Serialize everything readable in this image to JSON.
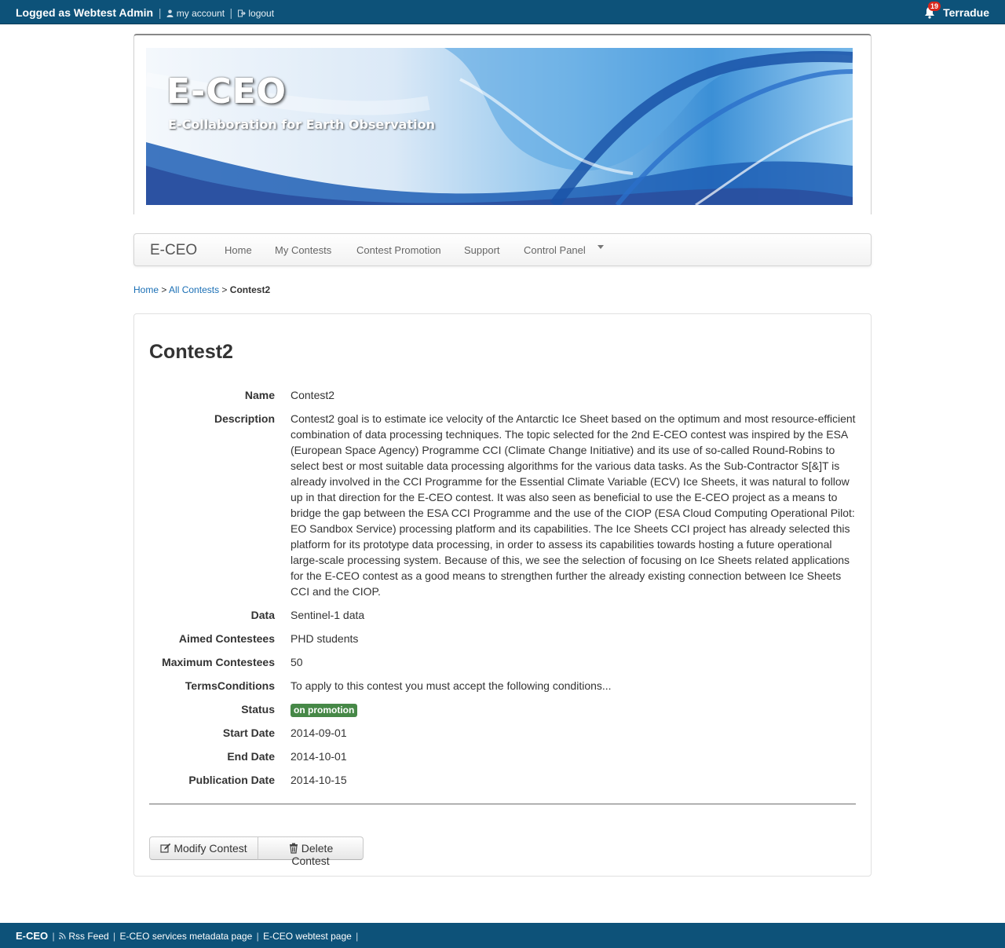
{
  "topbar": {
    "logged_as": "Logged as Webtest Admin",
    "my_account": "my account",
    "logout": "logout",
    "notification_count": "19",
    "org_name": "Terradue"
  },
  "banner": {
    "title": "E-CEO",
    "subtitle": "E-Collaboration for Earth Observation"
  },
  "navbar": {
    "brand": "E-CEO",
    "items": [
      "Home",
      "My Contests",
      "Contest Promotion",
      "Support",
      "Control Panel"
    ]
  },
  "breadcrumb": {
    "home": "Home",
    "all_contests": "All Contests",
    "current": "Contest2"
  },
  "contest": {
    "title": "Contest2",
    "labels": {
      "name": "Name",
      "description": "Description",
      "data": "Data",
      "aimed": "Aimed Contestees",
      "max": "Maximum Contestees",
      "terms": "TermsConditions",
      "status": "Status",
      "start": "Start Date",
      "end": "End Date",
      "publication": "Publication Date"
    },
    "values": {
      "name": "Contest2",
      "description": "Contest2 goal is to estimate ice velocity of the Antarctic Ice Sheet based on the optimum and most resource-efficient combination of data processing techniques. The topic selected for the 2nd E-CEO contest was inspired by the ESA (European Space Agency) Programme CCI (Climate Change Initiative) and its use of so-called Round-Robins to select best or most suitable data processing algorithms for the various data tasks. As the Sub-Contractor S[&]T is already involved in the CCI Programme for the Essential Climate Variable (ECV) Ice Sheets, it was natural to follow up in that direction for the E-CEO contest. It was also seen as beneficial to use the E-CEO project as a means to bridge the gap between the ESA CCI Programme and the use of the CIOP (ESA Cloud Computing Operational Pilot: EO Sandbox Service) processing platform and its capabilities. The Ice Sheets CCI project has already selected this platform for its prototype data processing, in order to assess its capabilities towards hosting a future operational large-scale processing system. Because of this, we see the selection of focusing on Ice Sheets related applications for the E-CEO contest as a good means to strengthen further the already existing connection between Ice Sheets CCI and the CIOP.",
      "data": "Sentinel-1 data",
      "aimed": "PHD students",
      "max": "50",
      "terms": "To apply to this contest you must accept the following conditions...",
      "status": "on promotion",
      "start": "2014-09-01",
      "end": "2014-10-01",
      "publication": "2014-10-15"
    },
    "status_color": "#468847"
  },
  "actions": {
    "modify": "Modify Contest",
    "delete": "Delete Contest"
  },
  "footer": {
    "brand": "E-CEO",
    "rss": "Rss Feed",
    "metadata": "E-CEO services metadata page",
    "webtest": "E-CEO webtest page"
  },
  "colors": {
    "topbar": "#0d5279",
    "link": "#1a6fb5"
  },
  "icons": [
    "user-icon",
    "logout-icon",
    "bell-icon",
    "caret-down-icon",
    "edit-icon",
    "trash-icon",
    "rss-icon"
  ]
}
